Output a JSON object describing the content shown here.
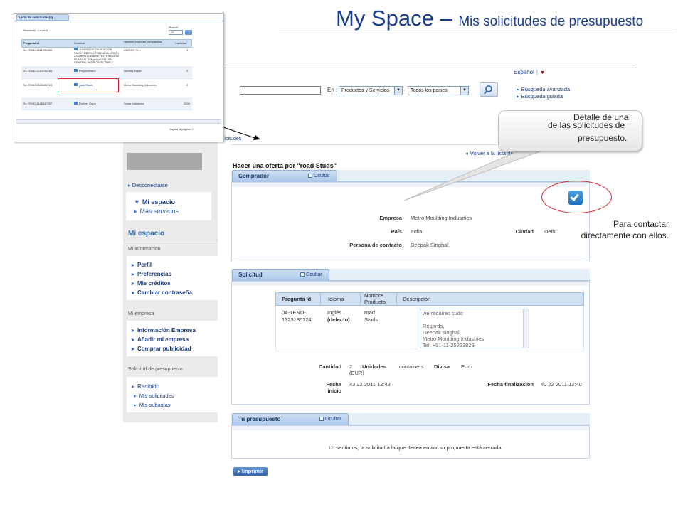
{
  "slide": {
    "title": "My Space",
    "dash": "–",
    "subtitle": "Mis solicitudes de presupuesto"
  },
  "header": {
    "language": "Español",
    "lang_separator": "|",
    "lang_arrow": "▼",
    "search_placeholder": "",
    "en_label": "En :",
    "category_select": "Productos y Servicios",
    "country_select": "Todos los paises",
    "advanced_search": "Búsqueda avanzada",
    "guided_search": "Búsqueda guiada"
  },
  "breadcrumb": "licitudes",
  "sidebar": {
    "logout": "Desconectarse",
    "mi_espacio_item": "Mi espacio",
    "mas_servicios": "Más servicios",
    "section_title": "Mi espacio",
    "groups": [
      {
        "heading": "Mi información",
        "items": [
          "Perfil",
          "Preferencias",
          "Mis créditos",
          "Cambiar contraseña"
        ]
      },
      {
        "heading": "Mi empresa",
        "items": [
          "Información Empresa",
          "Añadir mi empresa",
          "Comprar publicidad"
        ]
      },
      {
        "heading": "Solicitud de presupuesto",
        "items": [
          "Recibido",
          "Mis solicitudes",
          "Mis subastas"
        ]
      }
    ]
  },
  "main": {
    "title": "Hacer una oferta por \"road Studs\"",
    "back_link": "Volver a la lista de",
    "comprador": {
      "tab_label": "Comprador",
      "toggle": "Ocultar",
      "empresa_label": "Empresa",
      "empresa_value": "Metro Moulding Industries",
      "pais_label": "País",
      "pais_value": "India",
      "ciudad_label": "Ciudad",
      "ciudad_value": "Delhi",
      "contacto_label": "Persona de contacto",
      "contacto_value": "Deepak Singhal"
    },
    "solicitud": {
      "tab_label": "Solicitud",
      "toggle": "Ocultar",
      "headers": [
        "Pregunta Id",
        "Idioma",
        "Nombre Producto",
        "Descripción"
      ],
      "row": {
        "pregunta_id": "04-TEND-1323185724",
        "idioma": "Inglés",
        "idioma_default": "(defecto)",
        "producto": "road Studs",
        "descripcion": [
          "we requires suds",
          "",
          "Regards,",
          "Deepak singhal",
          "Metro Moulding Industries",
          "Tel: +91-11-25263829"
        ]
      },
      "cantidad_label": "Cantidad",
      "cantidad_value": "2",
      "unidades_label": "Unidades",
      "unidades_value": "containers",
      "divisa_label": "Divisa",
      "divisa_value": "Euro",
      "eur": "(EUR)",
      "fecha_inicio_label_1": "Fecha",
      "fecha_inicio_label_2": "inicio",
      "fecha_inicio_value": "43 22 2011 12:43",
      "fecha_fin_label": "Fecha finalización",
      "fecha_fin_value": "40 22 2011 12:40"
    },
    "presupuesto": {
      "tab_label": "Tu presupuesto",
      "toggle": "Ocultar",
      "message": "Lo sentimos, la solicitud a la que desea enviar su propuesta está cerrada."
    },
    "print_button": "Imprimir"
  },
  "annotations": {
    "callout_line1": "Detalle de una",
    "callout_line2": "de las solicitudes de",
    "callout_line3": "presupuesto.",
    "contact_note_1": "Para contactar",
    "contact_note_2": "directamente con ellos."
  },
  "inset": {
    "tab_label": "Lista de solicitudes(4)",
    "result_text": "Resultado: 1-4 de 4",
    "mostrar_label": "Mostrar:",
    "mostrar_value": "10",
    "headers": [
      "Pregunta Id",
      "Solicitud",
      "Nombre empresa compradora",
      "Cantidad"
    ],
    "rows": [
      {
        "id": "04-TEND-1361298980",
        "solicitud": "JUNTAS DE DILATACIÓN PARA TUBERIA FORZADA (JOBS) 2345mmOD DIAMETRO PRESIÓN NOMINAL 16Kgs/cm² EN UNA CENTRAL HIDROELÉCTRICA",
        "empresa": "UNITEC, S.L.",
        "cantidad": "1"
      },
      {
        "id": "04-TEND-1210294285",
        "solicitud": "Polyurethane",
        "empresa": "Novelty Import",
        "cantidad": "2"
      },
      {
        "id": "04-TEND-1323185724",
        "solicitud": "road Studs",
        "empresa": "Metro Moulding Industries",
        "cantidad": "2"
      },
      {
        "id": "04-TEND-1426047057",
        "solicitud": "Rubber Caps",
        "empresa": "Sonia Industries",
        "cantidad": "2000"
      }
    ],
    "footer": "Vaya a la página: 1"
  }
}
